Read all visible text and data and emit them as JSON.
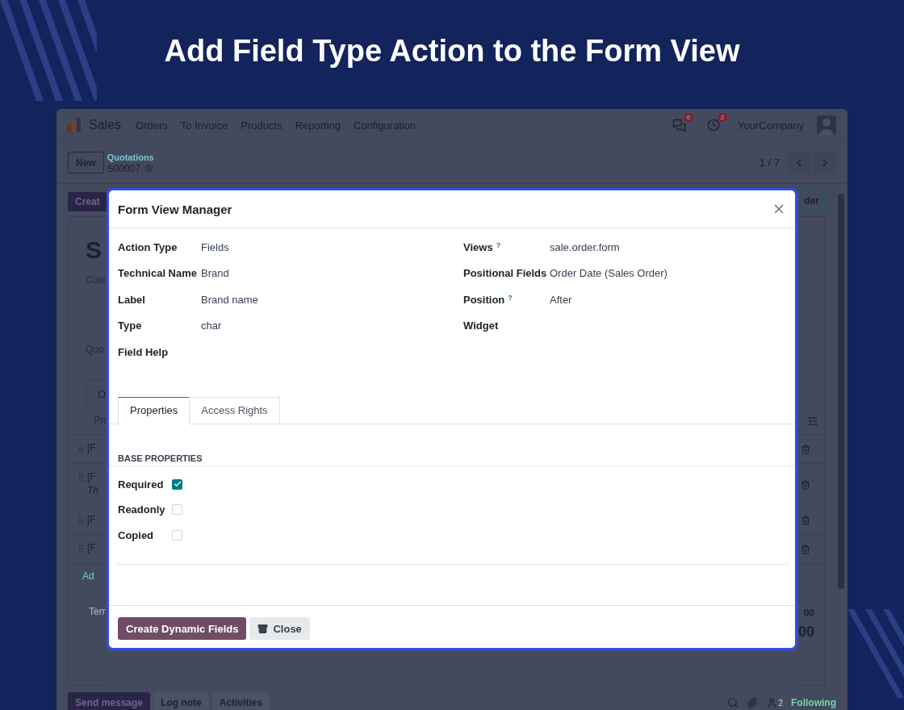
{
  "banner": {
    "title": "Add Field Type Action to the Form View"
  },
  "navbar": {
    "app": "Sales",
    "menu": [
      "Orders",
      "To Invoice",
      "Products",
      "Reporting",
      "Configuration"
    ],
    "messages_count": "6",
    "activities_count": "2",
    "company": "YourCompany"
  },
  "control_panel": {
    "new_button": "New",
    "breadcrumb": "Quotations",
    "record": "S00007",
    "pager": "1 / 7"
  },
  "background_form": {
    "create_button": "Creat",
    "title": "S",
    "customer_label": "Cust",
    "quotation_label": "Quo",
    "tab": "O",
    "column_header": "Pro",
    "lines": [
      {
        "text": "[F"
      },
      {
        "text": "[F",
        "note": "Th"
      },
      {
        "text": "[F"
      },
      {
        "text": "[F"
      }
    ],
    "add_line": "Ad",
    "terms": "Terr",
    "right_button": "der",
    "totals": [
      "00",
      "00"
    ]
  },
  "dialog": {
    "title": "Form View Manager",
    "left_fields": [
      {
        "label": "Action Type",
        "value": "Fields"
      },
      {
        "label": "Technical Name",
        "value": "Brand"
      },
      {
        "label": "Label",
        "value": "Brand name"
      },
      {
        "label": "Type",
        "value": "char"
      },
      {
        "label": "Field Help"
      }
    ],
    "right_fields": [
      {
        "label": "Views",
        "help": "?",
        "value": "sale.order.form"
      },
      {
        "label": "Positional Fields",
        "value": "Order Date (Sales Order)"
      },
      {
        "label": "Position",
        "help": "?",
        "value": "After"
      },
      {
        "label": "Widget"
      }
    ],
    "tabs": [
      {
        "label": "Properties",
        "selected": true
      },
      {
        "label": "Access Rights",
        "selected": false
      }
    ],
    "section_title": "BASE PROPERTIES",
    "checkboxes": [
      {
        "label": "Required",
        "checked": true
      },
      {
        "label": "Readonly",
        "checked": false
      },
      {
        "label": "Copied",
        "checked": false
      }
    ],
    "primary_button": "Create Dynamic Fields",
    "close_button": "Close"
  },
  "chatter": {
    "buttons": [
      "Send message",
      "Log note",
      "Activities"
    ],
    "followers_count": "2",
    "following": "Following"
  }
}
